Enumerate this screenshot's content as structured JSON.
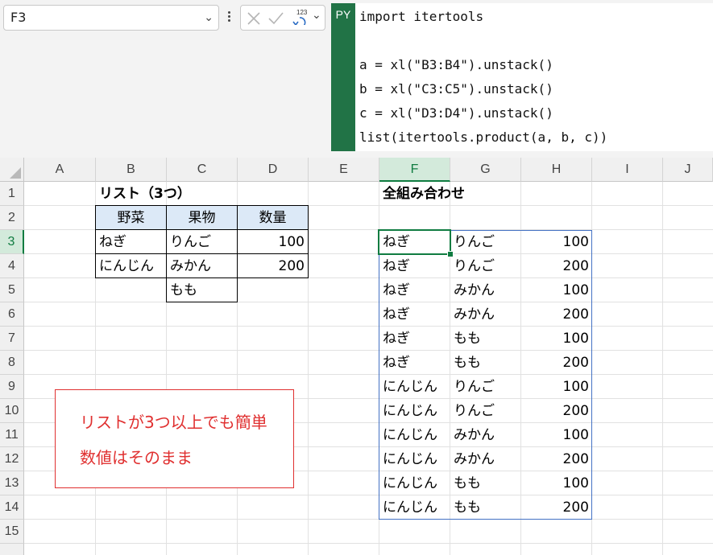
{
  "name_box": {
    "value": "F3",
    "chevron": "chevron-down-icon"
  },
  "formula_bar": {
    "icons": [
      "more-options-icon",
      "cancel-icon",
      "enter-icon",
      "convert-output-icon",
      "chevron-down-icon"
    ],
    "output_icon_label": "123",
    "py_badge": "PY",
    "code_lines": [
      "import itertools",
      "",
      "a = xl(\"B3:B4\").unstack()",
      "b = xl(\"C3:C5\").unstack()",
      "c = xl(\"D3:D4\").unstack()",
      "list(itertools.product(a, b, c))"
    ]
  },
  "grid": {
    "columns": [
      "A",
      "B",
      "C",
      "D",
      "E",
      "F",
      "G",
      "H",
      "I",
      "J"
    ],
    "rows": [
      "1",
      "2",
      "3",
      "4",
      "5",
      "6",
      "7",
      "8",
      "9",
      "10",
      "11",
      "12",
      "13",
      "14",
      "15"
    ],
    "selected_column": "F",
    "selected_row": "3"
  },
  "list_table": {
    "title": "リスト（3つ）",
    "headers": [
      "野菜",
      "果物",
      "数量"
    ],
    "vegetables": [
      "ねぎ",
      "にんじん"
    ],
    "fruits": [
      "りんご",
      "みかん",
      "もも"
    ],
    "quantities": [
      "100",
      "200"
    ]
  },
  "result": {
    "title": "全組み合わせ",
    "rows": [
      [
        "ねぎ",
        "りんご",
        "100"
      ],
      [
        "ねぎ",
        "りんご",
        "200"
      ],
      [
        "ねぎ",
        "みかん",
        "100"
      ],
      [
        "ねぎ",
        "みかん",
        "200"
      ],
      [
        "ねぎ",
        "もも",
        "100"
      ],
      [
        "ねぎ",
        "もも",
        "200"
      ],
      [
        "にんじん",
        "りんご",
        "100"
      ],
      [
        "にんじん",
        "りんご",
        "200"
      ],
      [
        "にんじん",
        "みかん",
        "100"
      ],
      [
        "にんじん",
        "みかん",
        "200"
      ],
      [
        "にんじん",
        "もも",
        "100"
      ],
      [
        "にんじん",
        "もも",
        "200"
      ]
    ]
  },
  "note": {
    "lines": [
      "リストが3つ以上でも簡単",
      "数値はそのまま"
    ],
    "color": "#e03030"
  },
  "colors": {
    "accent": "#107c41",
    "py_badge": "#217346",
    "spill_border": "#4472c4",
    "header_fill": "#dce9f7"
  }
}
